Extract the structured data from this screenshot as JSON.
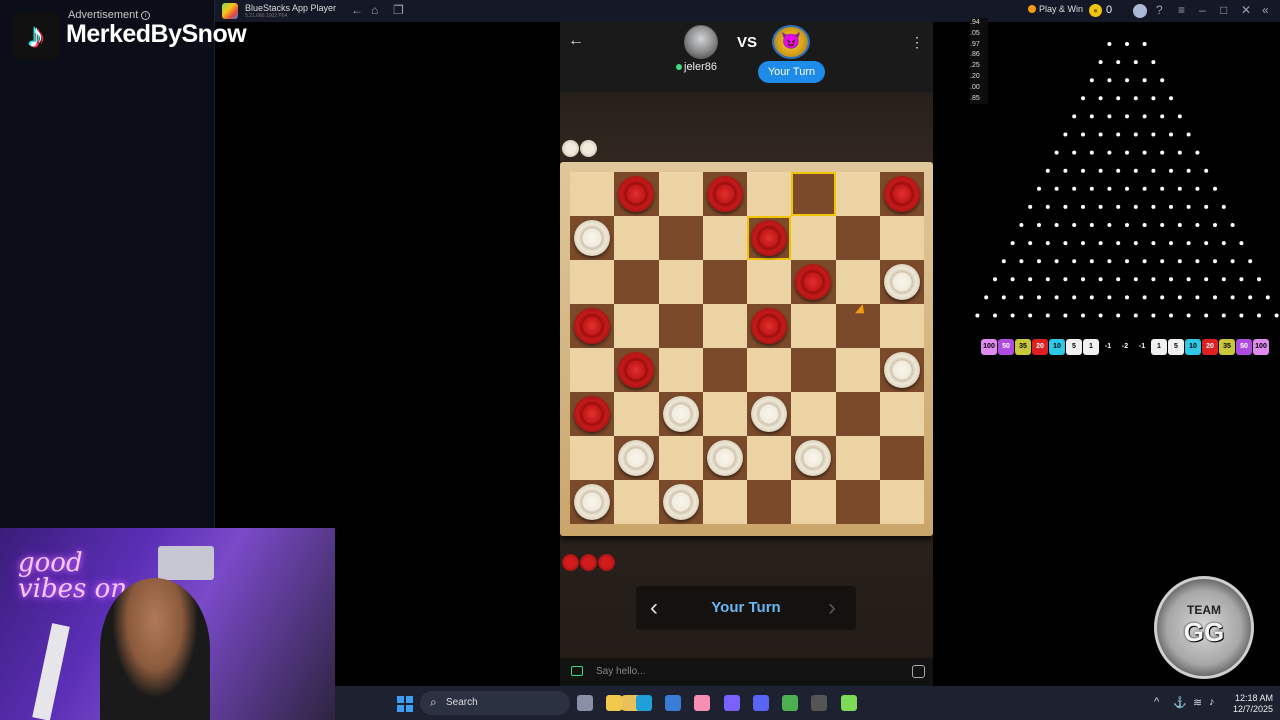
{
  "ad": {
    "label": "Advertisement",
    "info_icon": "i"
  },
  "stream": {
    "logo_icon": "tiktok-icon",
    "logo_glyph": "♪",
    "streamer_name": "MerkedBySnow"
  },
  "topbar": {
    "app_title": "BlueStacks App Player",
    "app_version": "5.21.660.1002 P64",
    "back_glyph": "←",
    "home_glyph": "⌂",
    "multi_glyph": "❐",
    "play_win_label": "Play & Win",
    "coin_glyph": "●",
    "coin_count": "0",
    "help_glyph": "?",
    "menu_glyph": "≡",
    "minimize_glyph": "–",
    "maximize_glyph": "□",
    "close_glyph": "✕",
    "sidebar_glyph": "«"
  },
  "game": {
    "back_glyph": "←",
    "menu_glyph": "⋮",
    "opponent_name": "jeler86",
    "vs_label": "VS",
    "my_avatar_glyph": "😈",
    "turn_badge": "Your Turn",
    "captured_top": [
      "white",
      "white"
    ],
    "captured_bottom": [
      "red",
      "red",
      "red"
    ],
    "board": [
      [
        ".",
        "r",
        ".",
        "r",
        ".",
        ".",
        ".",
        "r"
      ],
      [
        "w",
        ".",
        ".",
        ".",
        "r",
        ".",
        ".",
        "."
      ],
      [
        ".",
        ".",
        ".",
        ".",
        ".",
        "r",
        ".",
        "w"
      ],
      [
        "r",
        ".",
        ".",
        ".",
        "r",
        ".",
        ".",
        "."
      ],
      [
        ".",
        "r",
        ".",
        ".",
        ".",
        ".",
        ".",
        "w"
      ],
      [
        "r",
        ".",
        "w",
        ".",
        "w",
        ".",
        ".",
        "."
      ],
      [
        ".",
        "w",
        ".",
        "w",
        ".",
        "w",
        ".",
        "."
      ],
      [
        "w",
        ".",
        "w",
        ".",
        ".",
        ".",
        ".",
        "."
      ]
    ],
    "highlighted_squares": [
      [
        0,
        5
      ],
      [
        1,
        4
      ]
    ],
    "turn_bar": {
      "prev_glyph": "‹",
      "text": "Your Turn",
      "next_glyph": "›"
    },
    "chat_placeholder": "Say hello..."
  },
  "plinko": {
    "multipliers": [
      ".94",
      ".05",
      ".97",
      ".86",
      ".25",
      ".20",
      ".00",
      ".85"
    ],
    "rows": 16,
    "slots": [
      {
        "label": "100",
        "color": "#e08bf0"
      },
      {
        "label": "50",
        "color": "#b04be0"
      },
      {
        "label": "35",
        "color": "#c8c83a"
      },
      {
        "label": "20",
        "color": "#e02020"
      },
      {
        "label": "10",
        "color": "#2ec8e8"
      },
      {
        "label": "5",
        "color": "#f0f0f0"
      },
      {
        "label": "1",
        "color": "#f0f0f0"
      },
      {
        "label": "-1",
        "color": "#000000"
      },
      {
        "label": "-2",
        "color": "#000000"
      },
      {
        "label": "-1",
        "color": "#000000"
      },
      {
        "label": "1",
        "color": "#f0f0f0"
      },
      {
        "label": "5",
        "color": "#f0f0f0"
      },
      {
        "label": "10",
        "color": "#2ec8e8"
      },
      {
        "label": "20",
        "color": "#e02020"
      },
      {
        "label": "35",
        "color": "#c8c83a"
      },
      {
        "label": "50",
        "color": "#b04be0"
      },
      {
        "label": "100",
        "color": "#e08bf0"
      }
    ]
  },
  "team_logo": {
    "line1": "TEAM",
    "line2": "GG"
  },
  "webcam": {
    "neon_text": "good vibes on"
  },
  "taskbar": {
    "search_label": "Search",
    "search_glyph": "⌕",
    "time": "12:18 AM",
    "date": "12/7/2025",
    "apps": [
      {
        "name": "task-view-icon",
        "color": "#8a8fa8"
      },
      {
        "name": "file-explorer-icon",
        "color": "#f2c94c"
      },
      {
        "name": "edge-icon",
        "color": "#1fa0d8"
      },
      {
        "name": "store-icon",
        "color": "#3a7bd5"
      },
      {
        "name": "app-pink-icon",
        "color": "#f48fb1"
      },
      {
        "name": "copilot-icon",
        "color": "#7b61ff"
      },
      {
        "name": "discord-icon",
        "color": "#5865f2"
      },
      {
        "name": "app-green-icon",
        "color": "#4caf50"
      },
      {
        "name": "obs-icon",
        "color": "#555555"
      },
      {
        "name": "bluestacks-icon",
        "color": "#7ed957"
      }
    ],
    "tray": {
      "chevron_glyph": "^",
      "network_glyph": "⚓",
      "wifi_glyph": "≋",
      "volume_glyph": "♪"
    }
  }
}
